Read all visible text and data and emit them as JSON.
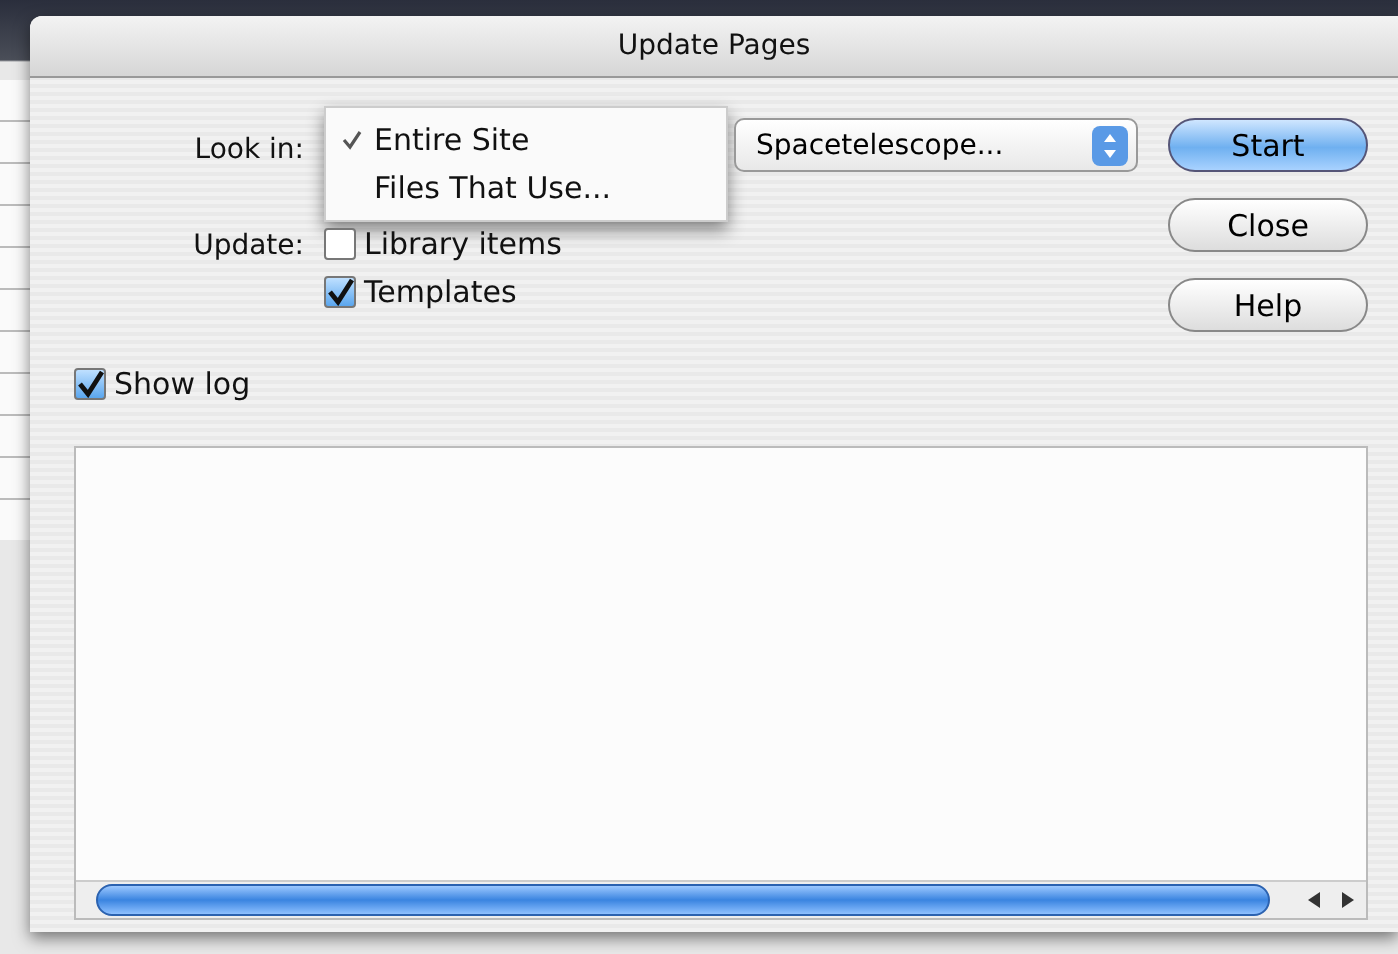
{
  "window": {
    "title": "Update Pages"
  },
  "look_in": {
    "label": "Look in:",
    "menu": [
      {
        "label": "Entire Site",
        "selected": true
      },
      {
        "label": "Files That Use...",
        "selected": false
      }
    ],
    "site": "Spacetelescope..."
  },
  "update": {
    "label": "Update:",
    "options": [
      {
        "label": "Library items",
        "checked": false
      },
      {
        "label": "Templates",
        "checked": true
      }
    ]
  },
  "show_log": {
    "label": "Show log",
    "checked": true
  },
  "buttons": [
    {
      "label": "Start",
      "default": true
    },
    {
      "label": "Close",
      "default": false
    },
    {
      "label": "Help",
      "default": false
    }
  ]
}
